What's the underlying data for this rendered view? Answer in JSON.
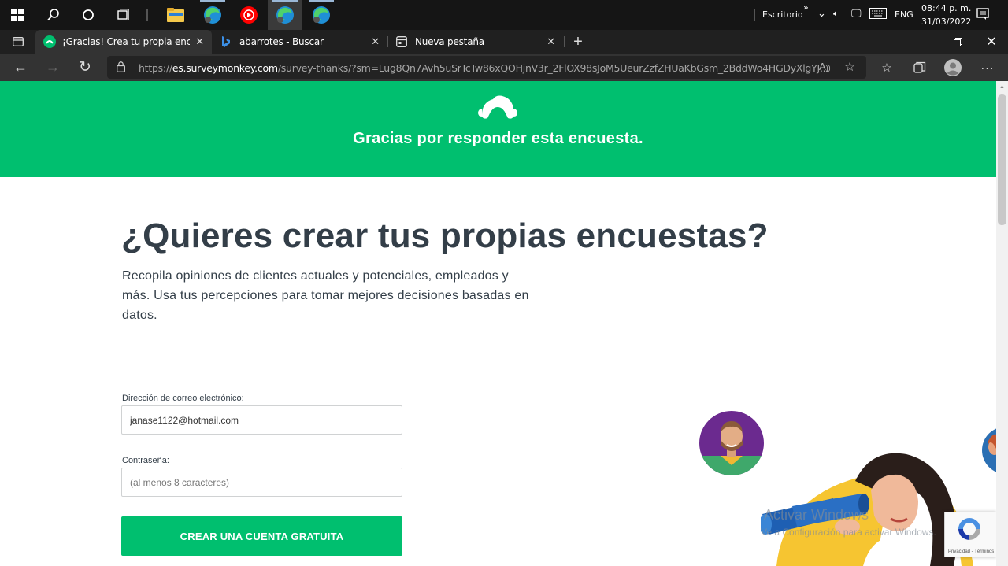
{
  "taskbar": {
    "tray_label": "Escritorio",
    "language": "ENG",
    "time": "08:44 p. m.",
    "date": "31/03/2022"
  },
  "tabs": [
    {
      "label": "¡Gracias! Crea tu propia encuesta",
      "icon": "surveymonkey-icon",
      "active": true
    },
    {
      "label": "abarrotes - Buscar",
      "icon": "bing-icon",
      "active": false
    },
    {
      "label": "Nueva pestaña",
      "icon": "new-tab-icon",
      "active": false
    }
  ],
  "address_bar": {
    "url_prefix": "https://",
    "url_domain": "es.surveymonkey.com",
    "url_path": "/survey-thanks/?sm=Lug8Qn7Avh5uSrTcTw86xQOHjnV3r_2FlOX98sJoM5UeurZzfZHUaKbGsm_2BddWo4HGDyXlgYJ..."
  },
  "hero": {
    "title": "Gracias por responder esta encuesta.",
    "background": "#00bf6f"
  },
  "main": {
    "heading": "¿Quieres crear tus propias encuestas?",
    "lead": "Recopila opiniones de clientes actuales y potenciales, empleados y más. Usa tus percepciones para tomar mejores decisiones basadas en datos."
  },
  "form": {
    "email_label": "Dirección de correo electrónico:",
    "email_value": "janase1122@hotmail.com",
    "password_label": "Contraseña:",
    "password_placeholder": "(al menos 8 caracteres)",
    "submit_label": "CREAR UNA CUENTA GRATUITA"
  },
  "watermark": {
    "line1": "Activar Windows",
    "line2": "Ve a Configuración para activar Windows."
  },
  "recaptcha": {
    "links": "Privacidad - Términos"
  }
}
